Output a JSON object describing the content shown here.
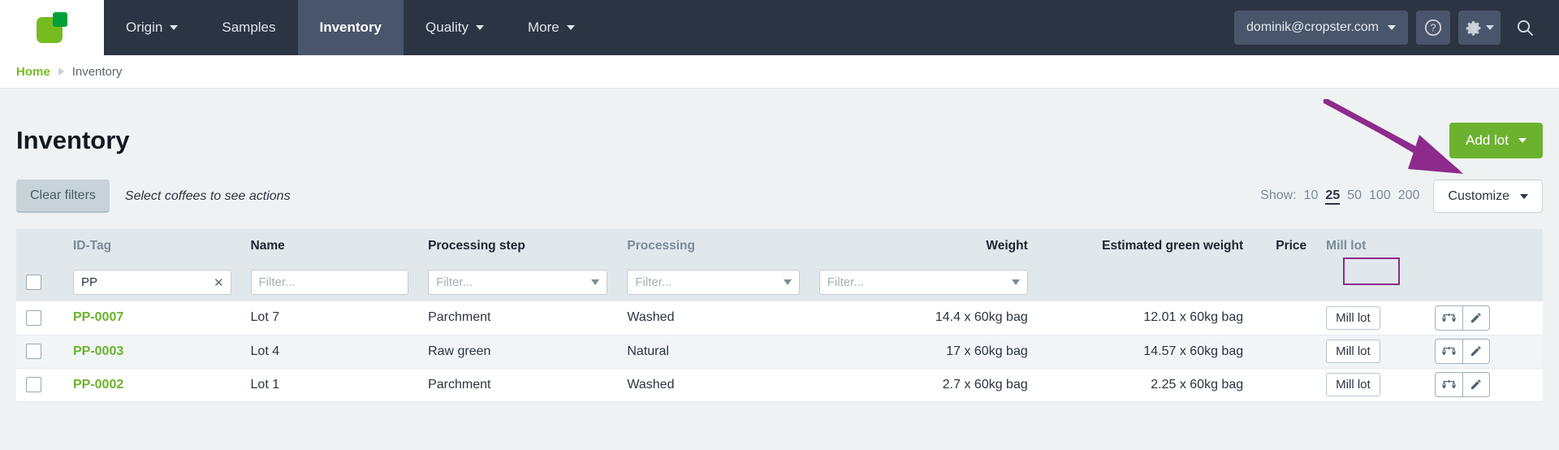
{
  "header": {
    "logo_name": "cropster-logo",
    "nav": [
      {
        "label": "Origin",
        "has_caret": true,
        "active": false
      },
      {
        "label": "Samples",
        "has_caret": false,
        "active": false
      },
      {
        "label": "Inventory",
        "has_caret": false,
        "active": true
      },
      {
        "label": "Quality",
        "has_caret": true,
        "active": false
      },
      {
        "label": "More",
        "has_caret": true,
        "active": false
      }
    ],
    "user_email": "dominik@cropster.com",
    "help_icon": "question-circle-icon",
    "settings_icon": "gear-icon",
    "search_icon": "search-icon",
    "bg_color": "#2b3442",
    "active_bg_color": "#49556a"
  },
  "breadcrumb": {
    "home": "Home",
    "current": "Inventory"
  },
  "page": {
    "title": "Inventory",
    "add_lot_label": "Add lot",
    "add_lot_color": "#6cb22e"
  },
  "toolbar": {
    "clear_filters_label": "Clear filters",
    "selection_hint": "Select coffees to see actions",
    "show_label": "Show:",
    "show_options": [
      "10",
      "25",
      "50",
      "100",
      "200"
    ],
    "show_selected": "25",
    "customize_label": "Customize"
  },
  "table": {
    "columns": [
      {
        "label": "ID-Tag",
        "align": "left",
        "muted": true
      },
      {
        "label": "Name",
        "align": "left",
        "muted": false
      },
      {
        "label": "Processing step",
        "align": "left",
        "muted": false
      },
      {
        "label": "Processing",
        "align": "left",
        "muted": true
      },
      {
        "label": "Weight",
        "align": "right",
        "muted": false
      },
      {
        "label": "Estimated green weight",
        "align": "right",
        "muted": false
      },
      {
        "label": "Price",
        "align": "right",
        "muted": false
      },
      {
        "label": "Mill lot",
        "align": "left",
        "muted": true
      }
    ],
    "filters": {
      "id_tag_value": "PP",
      "id_tag_clear": "✕",
      "name_placeholder": "Filter...",
      "processing_step_placeholder": "Filter...",
      "processing_placeholder": "Filter...",
      "weight_placeholder": "Filter..."
    },
    "rows": [
      {
        "id_tag": "PP-0007",
        "name": "Lot 7",
        "processing_step": "Parchment",
        "processing": "Washed",
        "weight": "14.4 x 60kg bag",
        "estimated_green_weight": "12.01 x 60kg bag",
        "price": "",
        "mill_lot_label": "Mill lot",
        "actions": [
          "scale-icon",
          "pencil-icon"
        ]
      },
      {
        "id_tag": "PP-0003",
        "name": "Lot 4",
        "processing_step": "Raw green",
        "processing": "Natural",
        "weight": "17 x 60kg bag",
        "estimated_green_weight": "14.57 x 60kg bag",
        "price": "",
        "mill_lot_label": "Mill lot",
        "actions": [
          "scale-icon",
          "pencil-icon"
        ]
      },
      {
        "id_tag": "PP-0002",
        "name": "Lot 1",
        "processing_step": "Parchment",
        "processing": "Washed",
        "weight": "2.7 x 60kg bag",
        "estimated_green_weight": "2.25 x 60kg bag",
        "price": "",
        "mill_lot_label": "Mill lot",
        "actions": [
          "scale-icon",
          "pencil-icon"
        ]
      }
    ]
  },
  "annotations": {
    "arrow_color": "#8e2a8b",
    "highlight_box_color": "#8e2a8b"
  }
}
